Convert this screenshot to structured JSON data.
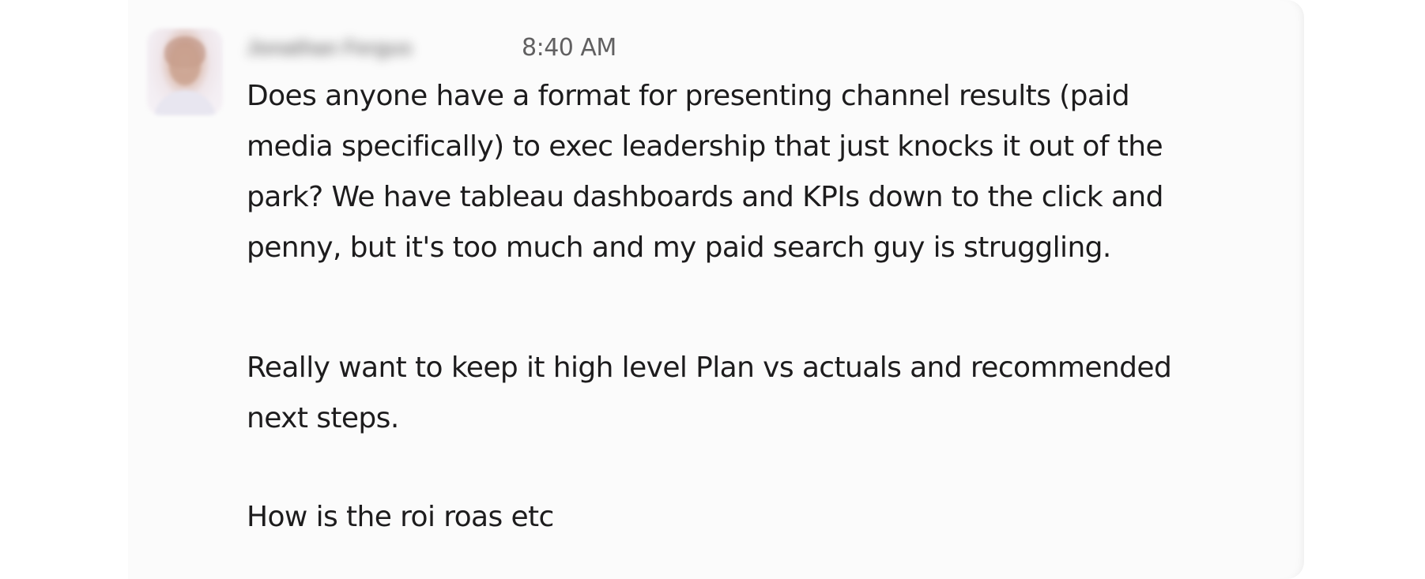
{
  "message": {
    "sender_name": "Jonathan Fergus",
    "timestamp": "8:40 AM",
    "paragraphs": [
      "Does anyone have a format for presenting channel results (paid\nmedia specifically) to exec leadership that just knocks it out of the\npark? We have tableau dashboards and KPIs down to the click and\npenny, but it's too much and my paid search guy is struggling.",
      "Really want to keep it high level Plan vs actuals and recommended\nnext steps.",
      "How is the roi roas etc"
    ]
  }
}
